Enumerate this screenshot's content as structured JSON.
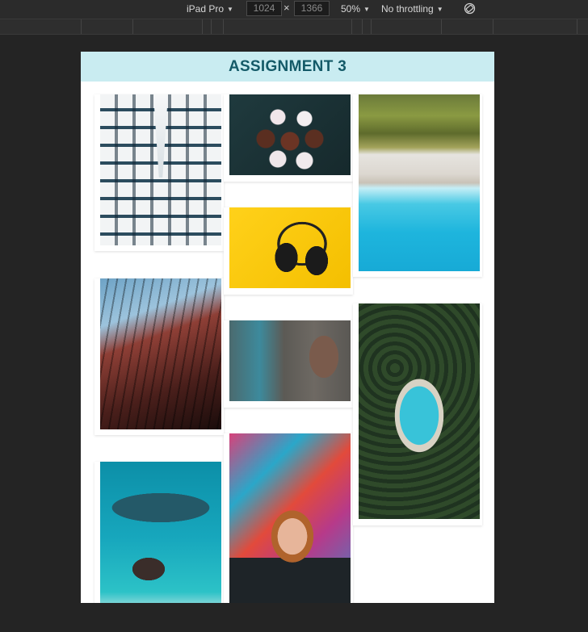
{
  "devtools": {
    "device": "iPad Pro",
    "width": "1024",
    "height": "1366",
    "times": "×",
    "zoom": "50%",
    "throttling": "No throttling",
    "caret": "▼"
  },
  "page": {
    "title": "ASSIGNMENT 3"
  },
  "gallery": {
    "photos": [
      {
        "name": "building-upward-photo"
      },
      {
        "name": "cupcakes-photo"
      },
      {
        "name": "beach-aerial-photo"
      },
      {
        "name": "curved-building-photo"
      },
      {
        "name": "headphones-photo"
      },
      {
        "name": "palm-forest-photo"
      },
      {
        "name": "graffiti-wall-photo"
      },
      {
        "name": "reef-aerial-photo"
      },
      {
        "name": "boy-graffiti-photo"
      }
    ]
  },
  "colors": {
    "header_bg": "#c9ecf1",
    "header_text": "#145a68",
    "devtools_bg": "#242424"
  }
}
